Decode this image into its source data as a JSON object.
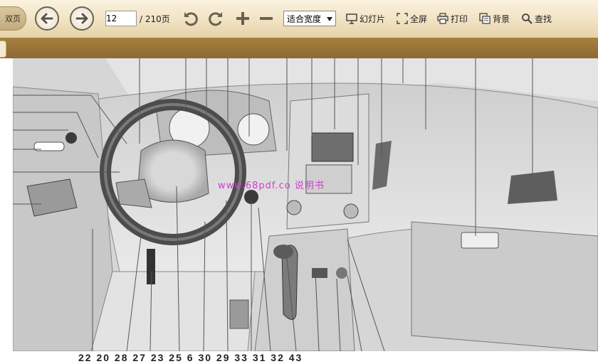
{
  "toolbar": {
    "double_page_label": "双页",
    "page_current": "12",
    "page_total": "/ 210页",
    "zoom_value": "适合宽度",
    "slideshow_label": "幻灯片",
    "fullscreen_label": "全屏",
    "print_label": "打印",
    "background_label": "背景",
    "find_label": "查找"
  },
  "document": {
    "watermark": "www.68pdf.co  说明书",
    "callout_numbers": "22  20  28  27  23  25  6  30  29  33  31  32  43"
  },
  "colors": {
    "toolbar_bg": "#f3e6c9",
    "strip_bg": "#9b763a",
    "watermark": "#d23bd2"
  },
  "icons": [
    "back-arrow-icon",
    "forward-arrow-icon",
    "rotate-left-icon",
    "rotate-right-icon",
    "zoom-in-icon",
    "zoom-out-icon",
    "slideshow-icon",
    "fullscreen-icon",
    "print-icon",
    "background-icon",
    "search-icon"
  ]
}
